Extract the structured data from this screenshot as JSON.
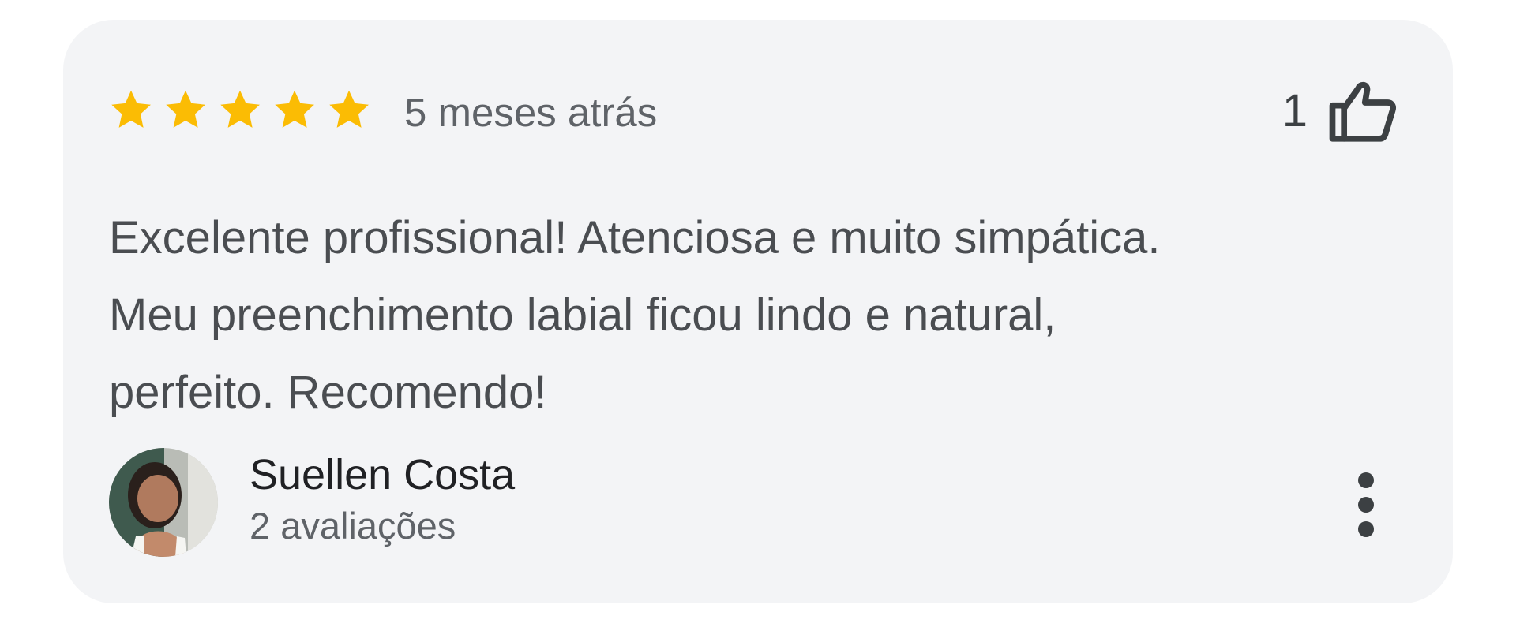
{
  "review": {
    "rating": 5,
    "rating_max": 5,
    "time_ago": "5 meses atrás",
    "likes": "1",
    "text": "Excelente profissional! Atenciosa e muito simpática.\nMeu preenchimento labial ficou lindo e natural,\nperfeito. Recomendo!",
    "author": {
      "name": "Suellen Costa",
      "reviews_count": "2 avaliações"
    },
    "icons": {
      "star": "star-icon",
      "like": "thumbs-up-icon",
      "more": "more-vert-icon"
    },
    "colors": {
      "star": "#fbbc04",
      "card_background": "#f3f4f6",
      "text": "#4a4d51"
    }
  }
}
